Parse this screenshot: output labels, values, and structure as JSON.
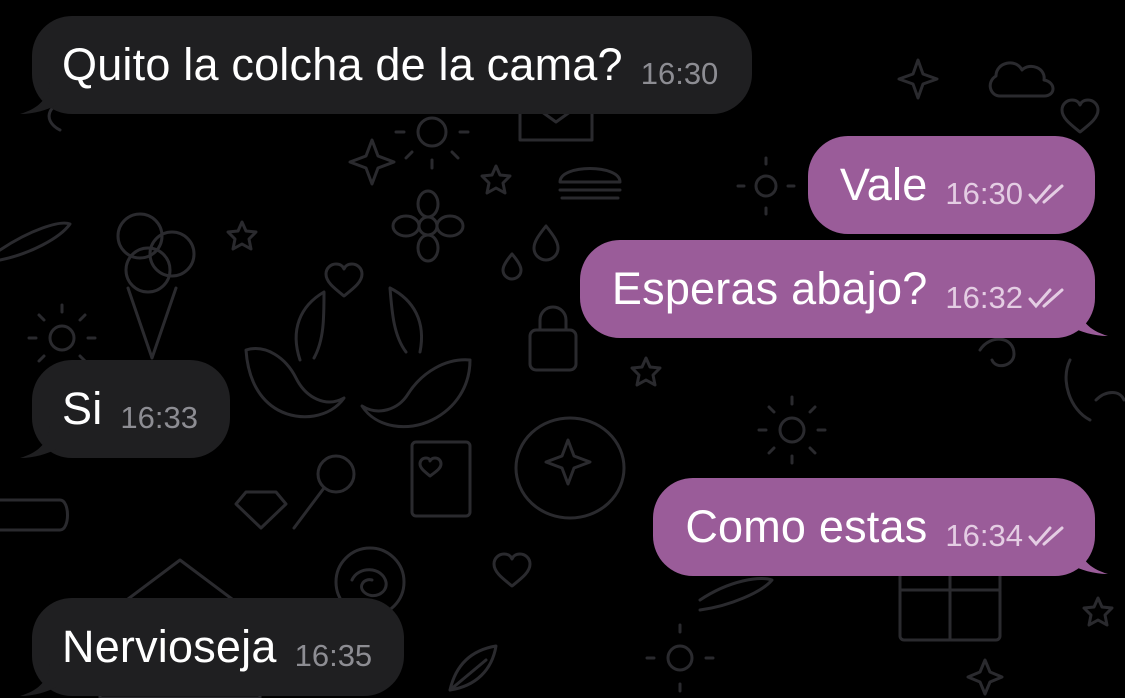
{
  "colors": {
    "background": "#000000",
    "incoming_bubble": "#1f1f21",
    "outgoing_bubble": "#9a5c99",
    "incoming_time": "#8d8d93",
    "outgoing_time": "#e4cde3",
    "wallpaper_doodles": "#2a2a2e"
  },
  "messages": [
    {
      "direction": "incoming",
      "text": "Quito la colcha de la cama?",
      "time": "16:30"
    },
    {
      "direction": "outgoing",
      "text": "Vale",
      "time": "16:30",
      "status": "read-double-check-icon"
    },
    {
      "direction": "outgoing",
      "text": "Esperas abajo?",
      "time": "16:32",
      "status": "read-double-check-icon"
    },
    {
      "direction": "incoming",
      "text": "Si",
      "time": "16:33"
    },
    {
      "direction": "outgoing",
      "text": "Como estas",
      "time": "16:34",
      "status": "read-double-check-icon"
    },
    {
      "direction": "incoming",
      "text": "Nervioseja",
      "time": "16:35"
    }
  ]
}
